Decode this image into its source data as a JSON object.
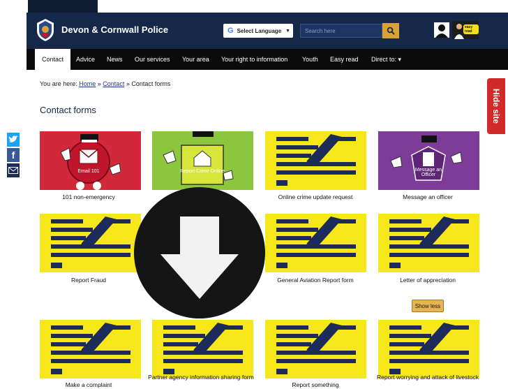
{
  "header": {
    "site_name": "Devon & Cornwall Police",
    "language_select_label": "Select Language",
    "search_placeholder": "Search here",
    "easy_read_badge": "easy read"
  },
  "nav": {
    "items": [
      "Contact",
      "Advice",
      "News",
      "Our services",
      "Your area",
      "Your right to information",
      "Youth",
      "Easy read",
      "Direct to: ▾"
    ]
  },
  "breadcrumb": {
    "prefix": "You are here:",
    "home": "Home",
    "separator": "»",
    "contact": "Contact",
    "current": "Contact forms"
  },
  "page_title": "Contact forms",
  "hide_site_label": "Hide site",
  "tiles": {
    "t1": {
      "label": "101 non-emergency",
      "art_text": "Email 101"
    },
    "t2": {
      "label": "",
      "art_text": "Report Crime Online"
    },
    "t3": {
      "label": "Online crime update request"
    },
    "t4": {
      "label": "Message an officer",
      "art_text": "Message an Officer"
    },
    "t5": {
      "label": "Report Fraud"
    },
    "t6": {
      "label": ""
    },
    "t7": {
      "label": "General Aviation Report form"
    },
    "t8": {
      "label": "Letter of appreciation"
    },
    "t9": {
      "label": "Make a complaint"
    },
    "t10": {
      "label": "Partner agency information sharing form"
    },
    "t11": {
      "label": "Report something"
    },
    "t12": {
      "label": "Report worrying and attack of livestock"
    }
  },
  "show_less_label": "Show less",
  "colors": {
    "header_bg": "#15284a",
    "nav_bg": "#0b0b0b",
    "tile_yellow": "#f5e71a",
    "tile_navy": "#1d2b5b",
    "tile_red": "#d1283a",
    "tile_green": "#8cc63f",
    "tile_purple": "#7d3c98",
    "hide_site": "#d12a2a"
  }
}
